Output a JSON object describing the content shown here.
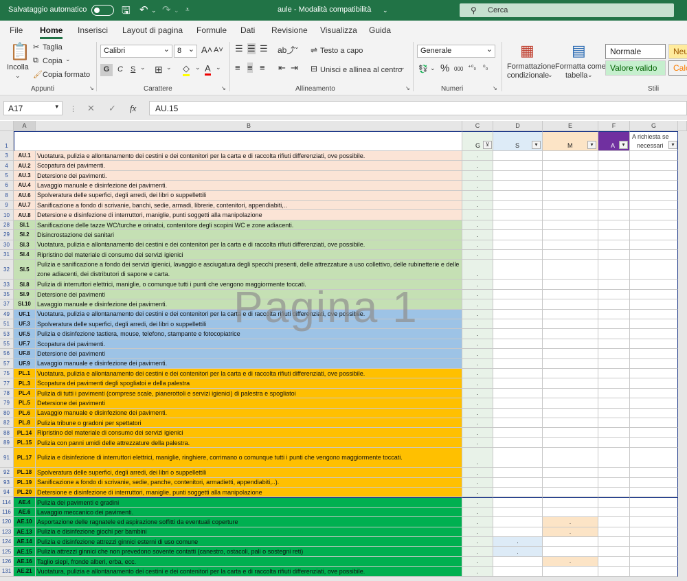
{
  "titlebar": {
    "autosave_label": "Salvataggio automatico",
    "doc_title": "aule - Modalità compatibilità",
    "search_label": "Cerca"
  },
  "menu": [
    "File",
    "Home",
    "Inserisci",
    "Layout di pagina",
    "Formule",
    "Dati",
    "Revisione",
    "Visualizza",
    "Guida"
  ],
  "ribbon": {
    "paste": "Incolla",
    "cut": "Taglia",
    "copy": "Copia",
    "format_painter": "Copia formato",
    "font_name": "Calibri",
    "font_size": "8",
    "bold": "G",
    "italic": "C",
    "underline": "S",
    "wrap": "Testo a capo",
    "merge": "Unisci e allinea al centro",
    "number_format": "Generale",
    "cond_format": "Formattazione",
    "cond_format_2": "condizionale",
    "format_table": "Formatta come",
    "format_table_2": "tabella",
    "style_normal": "Normale",
    "style_neutral": "Neut",
    "style_valid": "Valore valido",
    "style_calc": "Calco",
    "groups": {
      "clipboard": "Appunti",
      "font": "Carattere",
      "align": "Allineamento",
      "number": "Numeri",
      "styles": "Stili"
    }
  },
  "formula": {
    "namebox": "A17",
    "fx": "fx",
    "content": "AU.15"
  },
  "columns": [
    "A",
    "B",
    "C",
    "D",
    "E",
    "F",
    "G"
  ],
  "header": {
    "rownum": "1",
    "C": "G",
    "D": "S",
    "E": "M",
    "F": "A",
    "G1": "A richiesta se",
    "G2": "necessari"
  },
  "watermark": "Pagina 1",
  "colors": {
    "au": "#fbe4d6",
    "si": "#c5e0b4",
    "uf": "#9dc3e6",
    "pl": "#ffc000",
    "ae": "#00b050",
    "accent": "#217346"
  },
  "rows": [
    {
      "n": "3",
      "code": "AU.1",
      "text": "Vuotatura, pulizia e  allontanamento dei cestini e  dei contenitori per  la carta  e di raccolta rifiuti differenziati, ove possibile.",
      "g": "AU"
    },
    {
      "n": "4",
      "code": "AU.2",
      "text": "Scopatura dei pavimenti.",
      "g": "AU"
    },
    {
      "n": "5",
      "code": "AU.3",
      "text": "Detersione dei pavimenti.",
      "g": "AU"
    },
    {
      "n": "6",
      "code": "AU.4",
      "text": "Lavaggio manuale e disinfezione dei pavimenti.",
      "g": "AU"
    },
    {
      "n": "8",
      "code": "AU.6",
      "text": "Spolveratura  delle  superfici,  degli  arredi,  dei  libri  o suppellettili",
      "g": "AU"
    },
    {
      "n": "9",
      "code": "AU.7",
      "text": "Sanificazione   a   fondo   di   scrivanie,   banchi,   sedie, armadi, librerie, contenitori, appendiabiti,..",
      "g": "AU"
    },
    {
      "n": "10",
      "code": "AU.8",
      "text": "Detersione e disinfezione di interruttori, maniglie, punti soggetti alla manipolazione",
      "g": "AU"
    },
    {
      "n": "28",
      "code": "SI.1",
      "text": "Sanificazione delle tazze WC/turche  e orinatoi, contenitore degli scopini WC e zone  adiacenti.",
      "g": "SI"
    },
    {
      "n": "29",
      "code": "SI.2",
      "text": "Disincrostazione dei sanitari",
      "g": "SI"
    },
    {
      "n": "30",
      "code": "SI.3",
      "text": "Vuotatura, pulizia e allontanamento dei cestini e dei contenitori per la carta  e di raccolta rifiuti differenziati, ove possibile.",
      "g": "SI"
    },
    {
      "n": "31",
      "code": "SI.4",
      "text": "Ripristino del materiale di consumo dei servizi igienici",
      "g": "SI"
    },
    {
      "n": "32",
      "code": "SI.5",
      "text": "Pulizia e sanificazione a fondo dei servizi igienici, lavaggio e asciugatura degli specchi presenti, delle attrezzature a uso collettivo, delle rubinetterie e delle zone  adiacenti, dei distributori di sapone e carta.",
      "g": "SI",
      "tall": true
    },
    {
      "n": "33",
      "code": "SI.8",
      "text": "Pulizia di interruttori elettrici, maniglie, o comunque tutti i punti che  vengono maggiormente toccati.",
      "g": "SI"
    },
    {
      "n": "35",
      "code": "SI.9",
      "text": "Detersione dei pavimenti",
      "g": "SI"
    },
    {
      "n": "37",
      "code": "SI.10",
      "text": "Lavaggio manuale e disinfezione dei pavimenti.",
      "g": "SI"
    },
    {
      "n": "49",
      "code": "UF.1",
      "text": "Vuotatura, pulizia e  allontanamento dei cestini e  dei contenitori per  la carta  e di raccolta rifiuti differenziati, ove possibile.",
      "g": "UF"
    },
    {
      "n": "51",
      "code": "UF.3",
      "text": "Spolveratura  delle  superfici,  degli  arredi,  dei  libri  o suppellettili",
      "g": "UF"
    },
    {
      "n": "53",
      "code": "UF.5",
      "text": "Pulizia    e    disinfezione   tastiera,    mouse,   telefono, stampante e fotocopiatrice",
      "g": "UF"
    },
    {
      "n": "55",
      "code": "UF.7",
      "text": "Scopatura dei pavimenti.",
      "g": "UF"
    },
    {
      "n": "56",
      "code": "UF.8",
      "text": "Detersione dei pavimenti",
      "g": "UF"
    },
    {
      "n": "57",
      "code": "UF.9",
      "text": "Lavaggio manuale e disinfezione dei pavimenti.",
      "g": "UF"
    },
    {
      "n": "75",
      "code": "PL.1",
      "text": "Vuotatura, pulizia e  allontanamento dei cestini e  dei contenitori per  la carta  e di raccolta rifiuti differenziati, ove possibile.",
      "g": "PL"
    },
    {
      "n": "77",
      "code": "PL.3",
      "text": "Scopatura  dei   pavimenti   degli   spogliatoi   e   della palestra",
      "g": "PL"
    },
    {
      "n": "78",
      "code": "PL.4",
      "text": "Pulizia di tutti i pavimenti (comprese scale, pianerottoli e servizi igienici) di palestra e spogliatoi",
      "g": "PL"
    },
    {
      "n": "79",
      "code": "PL.5",
      "text": "Detersione dei pavimenti",
      "g": "PL"
    },
    {
      "n": "80",
      "code": "PL.6",
      "text": "Lavaggio manuale e disinfezione dei pavimenti.",
      "g": "PL"
    },
    {
      "n": "82",
      "code": "PL.8",
      "text": "Pulizia tribune o gradoni per spettatori",
      "g": "PL"
    },
    {
      "n": "88",
      "code": "PL.14",
      "text": "Ripristino del materiale di consumo dei servizi igienici",
      "g": "PL"
    },
    {
      "n": "89",
      "code": "PL.15",
      "text": "Pulizia   con   panni   umidi   delle   attrezzature   della palestra.",
      "g": "PL"
    },
    {
      "n": "91",
      "code": "PL.17",
      "text": "Pulizia e  disinfezione di interruttori elettrici, maniglie, ringhiere, corrimano o comunque tutti i punti che vengono maggiormente toccati.",
      "g": "PL",
      "tall": true
    },
    {
      "n": "92",
      "code": "PL.18",
      "text": "Spolveratura  delle  superfici,  degli  arredi,  dei  libri  o suppellettili",
      "g": "PL"
    },
    {
      "n": "93",
      "code": "PL.19",
      "text": "Sanificazione   a   fondo   di   scrivanie,   sedie,   panche, contenitori, armadietti, appendiabiti,..).",
      "g": "PL"
    },
    {
      "n": "94",
      "code": "PL.20",
      "text": "Detersione e disinfezione di interruttori, maniglie, punti soggetti alla manipolazione",
      "g": "PL"
    },
    {
      "n": "114",
      "code": "AE.4",
      "text": "Pulizia dei pavimenti e gradini",
      "g": "AE"
    },
    {
      "n": "116",
      "code": "AE.6",
      "text": "Lavaggio meccanico dei pavimenti.",
      "g": "AE"
    },
    {
      "n": "120",
      "code": "AE.10",
      "text": "Asportazione delle ragnatele ed aspirazione soffitti da eventuali coperture",
      "g": "AE",
      "e": true
    },
    {
      "n": "123",
      "code": "AE.13",
      "text": "Pulizia e disinfezione giochi per bambini",
      "g": "AE",
      "e": true
    },
    {
      "n": "124",
      "code": "AE.14",
      "text": "Pulizia e disinfezione attrezzi ginnici esterni di uso comune",
      "g": "AE",
      "d": true
    },
    {
      "n": "125",
      "code": "AE.15",
      "text": "Pulizia attrezzi ginnici che  non  prevedono sovente contatti (canestro, ostacoli, pali o sostegni reti)",
      "g": "AE",
      "d": true
    },
    {
      "n": "126",
      "code": "AE.16",
      "text": "Taglio siepi, fronde alberi, erba, ecc.",
      "g": "AE",
      "e": true
    },
    {
      "n": "131",
      "code": "AE.21",
      "text": "Vuotatura, pulizia e  allontanamento dei cestini e  dei contenitori per  la carta  e di raccolta rifiuti differenziati, ove possibile.",
      "g": "AE"
    }
  ],
  "dot": "."
}
